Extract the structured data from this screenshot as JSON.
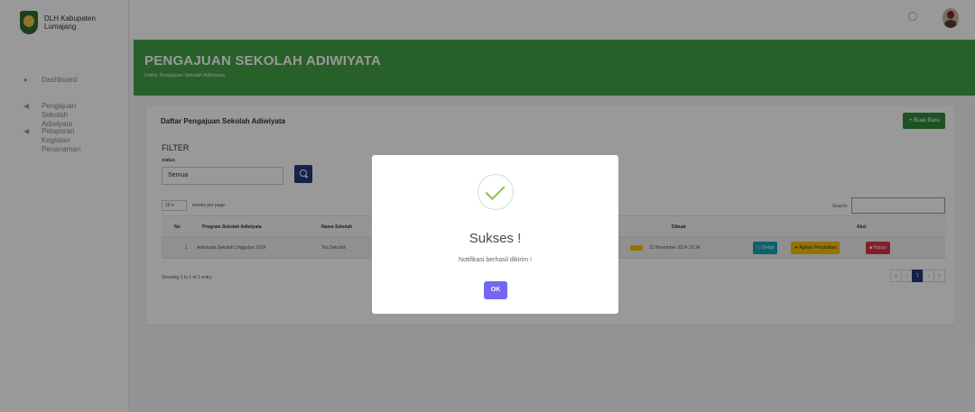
{
  "brand": {
    "line1": "DLH Kabupaten",
    "line2": "Lumajang"
  },
  "sidebar": {
    "items": [
      {
        "label": "Dashboard",
        "icon": "dashboard-icon"
      },
      {
        "label": "Pengajuan Sekolah Adiwiyata",
        "icon": "send-icon"
      },
      {
        "label": "Pelaporan Kegiatan Penanaman",
        "icon": "send-icon"
      }
    ]
  },
  "header": {
    "title": "PENGAJUAN SEKOLAH ADIWIYATA",
    "subtitle": "Daftar Pengajuan Sekolah Adiwiyata"
  },
  "card": {
    "title": "Daftar Pengajuan Sekolah Adiwiyata",
    "new_button": "+ Buat Baru",
    "filter_label": "FILTER",
    "status_label": "status",
    "status_value": "Semua",
    "length_value": "10",
    "length_text": "entries per page",
    "search_label": "Search:",
    "columns": {
      "no": "No",
      "program": "Program Sekolah Adiwiyata",
      "nama": "Nama Sekolah",
      "dibuat": "Dibuat",
      "aksi": "Aksi"
    },
    "rows": [
      {
        "no": "1",
        "program": "Adiwiyata Sekolah Unggulan 2024",
        "nama": "Tes Sekolah",
        "dibuat": "22 November 2024 16:34",
        "detail": "Detail",
        "ajukan": "Ajukan Perubahan",
        "hapus": "Hapus"
      }
    ],
    "showing": "Showing 1 to 1 of 1 entry",
    "pager": {
      "prev2": "«",
      "prev": "‹",
      "page": "1",
      "next": "›",
      "next2": "»"
    }
  },
  "modal": {
    "icon": "success-check-icon",
    "title": "Sukses !",
    "text": "Notifikasi berhasil dikirim !",
    "ok": "OK"
  },
  "colors": {
    "header_green": "#43a047",
    "primary_navy": "#253a7a",
    "modal_button": "#7367f0"
  }
}
